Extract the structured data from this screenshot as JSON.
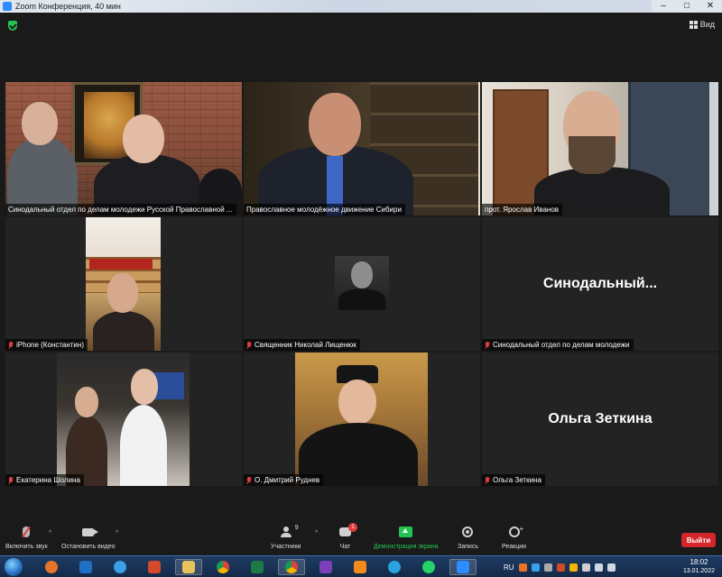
{
  "window": {
    "title": "Zoom Конференция, 40 мин",
    "controls": {
      "minimize": "–",
      "maximize": "□",
      "close": "✕"
    }
  },
  "topbar": {
    "view_label": "Вид",
    "icons": {
      "security": "shield-check-icon",
      "view": "grid-view-icon"
    }
  },
  "tiles": [
    {
      "name": "Синодальный отдел по делам молодежи Русской Православной ...",
      "muted": false,
      "active": false,
      "video": true
    },
    {
      "name": "Православное молодёжное движение Сибири",
      "muted": false,
      "active": false,
      "video": true
    },
    {
      "name": "прот. Ярослав Иванов",
      "muted": false,
      "active": true,
      "video": true
    },
    {
      "name": "iPhone (Константин)",
      "muted": true,
      "active": false,
      "video": true
    },
    {
      "name": "Священник Николай Лищенюк",
      "muted": true,
      "active": false,
      "video": false,
      "avatar": true
    },
    {
      "name": "Синодальный отдел по делам молодежи",
      "muted": true,
      "active": false,
      "video": false,
      "display_name": "Синодальный..."
    },
    {
      "name": "Екатерина Шолина",
      "muted": true,
      "active": false,
      "video": true
    },
    {
      "name": "О. Дмитрий Руднев",
      "muted": true,
      "active": false,
      "video": false,
      "avatar": true
    },
    {
      "name": "Ольга Зеткина",
      "muted": true,
      "active": false,
      "video": false,
      "display_name": "Ольга Зеткина"
    }
  ],
  "toolbar": {
    "unmute_label": "Включить звук",
    "stop_video_label": "Остановить видео",
    "participants_label": "Участники",
    "participants_count": "9",
    "chat_label": "Чат",
    "chat_badge": "1",
    "share_label": "Демонстрация экрана",
    "record_label": "Запись",
    "reactions_label": "Реакции",
    "leave_label": "Выйти",
    "caret": "^",
    "plus": "+"
  },
  "taskbar": {
    "language": "RU",
    "time": "18:02",
    "date": "13.01.2022",
    "apps": [
      "tool-app-icon",
      "outlook-icon",
      "ie-icon",
      "folder-icon",
      "chrome-icon",
      "excel-icon",
      "chrome-icon",
      "visual-studio-icon",
      "media-player-icon",
      "telegram-icon",
      "whatsapp-icon",
      "zoom-icon"
    ]
  },
  "colors": {
    "accent_green": "#23c552",
    "active_speaker": "#d7e34a",
    "leave_red": "#d4262a",
    "muted_red": "#e23c3c"
  }
}
